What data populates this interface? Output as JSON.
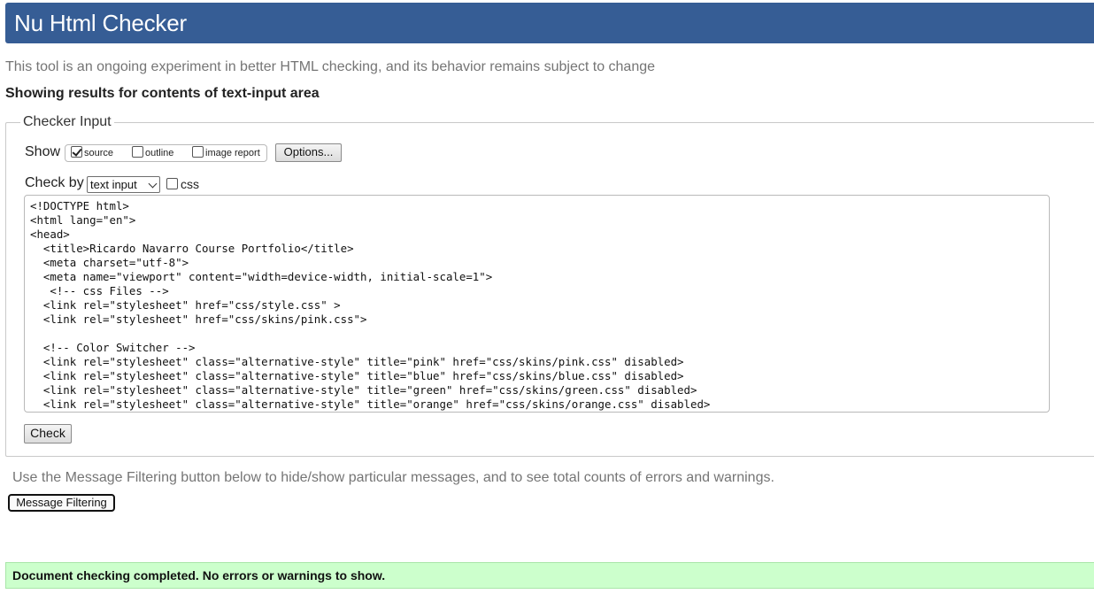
{
  "header": {
    "title": "Nu Html Checker"
  },
  "intro": "This tool is an ongoing experiment in better HTML checking, and its behavior remains subject to change",
  "showing": "Showing results for contents of text-input area",
  "checker_input": {
    "legend": "Checker Input",
    "show_label": "Show",
    "show_options": [
      {
        "label": "source",
        "checked": true
      },
      {
        "label": "outline",
        "checked": false
      },
      {
        "label": "image report",
        "checked": false
      }
    ],
    "options_button": "Options...",
    "check_by_label": "Check by",
    "check_by_value": "text input",
    "css_label": "css",
    "source_text": "<!DOCTYPE html>\n<html lang=\"en\">\n<head>\n  <title>Ricardo Navarro Course Portfolio</title>\n  <meta charset=\"utf-8\">\n  <meta name=\"viewport\" content=\"width=device-width, initial-scale=1\">\n   <!-- css Files -->\n  <link rel=\"stylesheet\" href=\"css/style.css\" >\n  <link rel=\"stylesheet\" href=\"css/skins/pink.css\">\n\n  <!-- Color Switcher -->\n  <link rel=\"stylesheet\" class=\"alternative-style\" title=\"pink\" href=\"css/skins/pink.css\" disabled>\n  <link rel=\"stylesheet\" class=\"alternative-style\" title=\"blue\" href=\"css/skins/blue.css\" disabled>\n  <link rel=\"stylesheet\" class=\"alternative-style\" title=\"green\" href=\"css/skins/green.css\" disabled>\n  <link rel=\"stylesheet\" class=\"alternative-style\" title=\"orange\" href=\"css/skins/orange.css\" disabled>",
    "check_button": "Check"
  },
  "filter_note": "Use the Message Filtering button below to hide/show particular messages, and to see total counts of errors and warnings.",
  "filter_button": "Message Filtering",
  "result_message": "Document checking completed. No errors or warnings to show.",
  "colors": {
    "header_bg": "#365d95",
    "success_bg": "#ccffcc"
  }
}
